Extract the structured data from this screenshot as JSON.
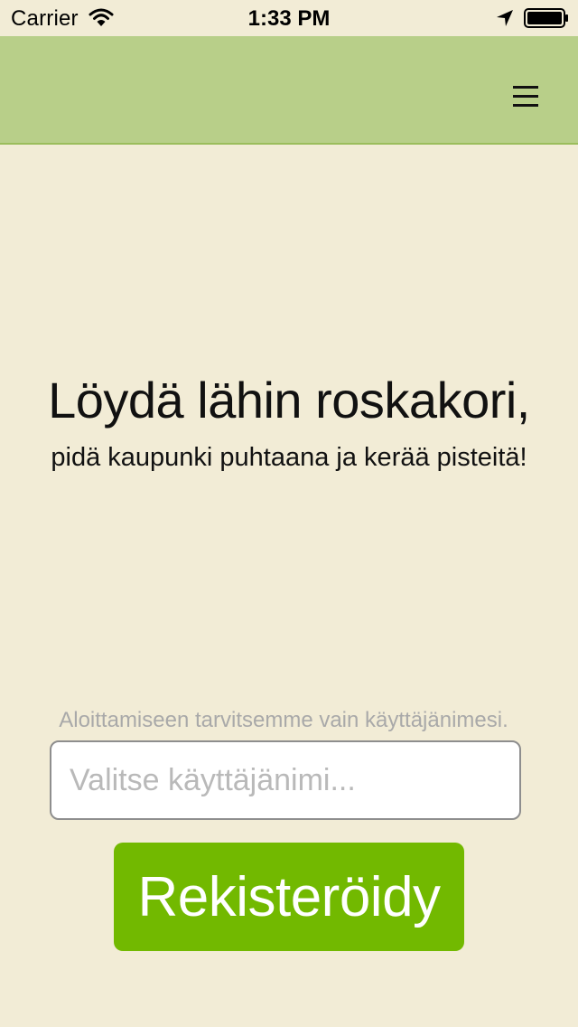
{
  "status_bar": {
    "carrier": "Carrier",
    "time": "1:33 PM",
    "icons": [
      "wifi-icon",
      "location-arrow-icon",
      "battery-icon"
    ]
  },
  "nav_bar": {
    "menu_icon": "hamburger-menu-icon"
  },
  "hero": {
    "title": "Löydä lähin roskakori,",
    "subtitle": "pidä kaupunki puhtaana ja kerää pisteitä!"
  },
  "form": {
    "hint": "Aloittamiseen tarvitsemme vain käyttäjänimesi.",
    "username_value": "",
    "username_placeholder": "Valitse käyttäjänimi...",
    "register_label": "Rekisteröidy"
  },
  "colors": {
    "background": "#f2ecd6",
    "nav_bar": "#b8cf89",
    "register_button": "#72b900",
    "hint_text": "#a9a9a9"
  }
}
